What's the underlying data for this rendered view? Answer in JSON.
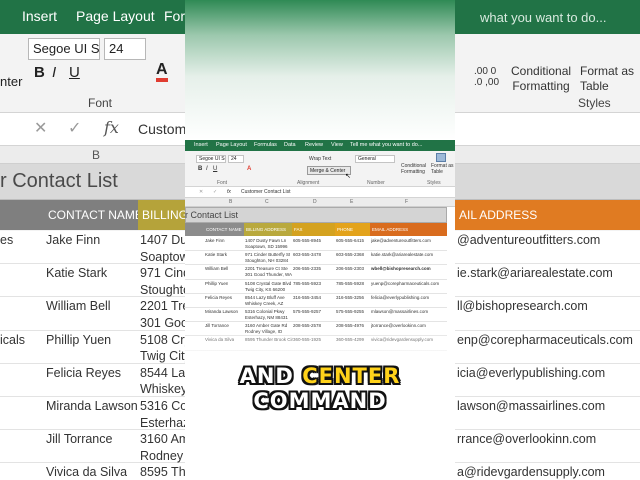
{
  "background": {
    "tabs": [
      "Insert",
      "Page Layout",
      "Form"
    ],
    "tell_me": "what you want to do...",
    "font_name": "Segoe UI Se",
    "font_size": "24",
    "bold": "B",
    "italic": "I",
    "underline": "U",
    "font_color_glyph": "A",
    "font_group_label": "Font",
    "enter_label": "nter",
    "number_small": ".00 0\n.0 ,00",
    "conditional_formatting": "Conditional\nFormatting",
    "format_as_table": "Format as\nTable",
    "styles_label": "Styles",
    "fx": "fx",
    "formula_value": "Custome",
    "column_b": "B",
    "title": "r Contact List",
    "headers": [
      "CONTACT NAME",
      "BILLING A",
      "AIL ADDRESS"
    ],
    "header_colors": [
      "#7f7f7f",
      "#b5a33a",
      "#e07b22"
    ],
    "rows": [
      {
        "a": "es",
        "name": "Jake Finn",
        "addr": "1407 Dus",
        "email": "@adventureoutfitters.com"
      },
      {
        "a": "",
        "name": "",
        "addr": "Soaptown",
        "email": ""
      },
      {
        "a": "",
        "name": "Katie Stark",
        "addr": "971 Cinde",
        "email": "ie.stark@ariarealestate.com"
      },
      {
        "a": "",
        "name": "",
        "addr": "Stoughton",
        "email": ""
      },
      {
        "a": "",
        "name": "William Bell",
        "addr": "2201 Trea",
        "email": "ll@bishopresearch.com"
      },
      {
        "a": "",
        "name": "",
        "addr": "301 Good",
        "email": ""
      },
      {
        "a": "icals",
        "name": "Phillip Yuen",
        "addr": "5108 Cry",
        "email": "enp@corepharmaceuticals.com"
      },
      {
        "a": "",
        "name": "",
        "addr": "Twig City,",
        "email": ""
      },
      {
        "a": "",
        "name": "Felicia Reyes",
        "addr": "8544 Laz",
        "email": "icia@everlypublishing.com"
      },
      {
        "a": "",
        "name": "",
        "addr": "Whiskey C",
        "email": ""
      },
      {
        "a": "",
        "name": "Miranda Lawson",
        "addr": "5316 Col",
        "email": "lawson@massairlines.com"
      },
      {
        "a": "",
        "name": "",
        "addr": "Esterhazy,",
        "email": ""
      },
      {
        "a": "",
        "name": "Jill Torrance",
        "addr": "3160 Amb",
        "email": "rrance@overlookinn.com"
      },
      {
        "a": "",
        "name": "",
        "addr": "Rodney V",
        "email": ""
      },
      {
        "a": "",
        "name": "Vivica da Silva",
        "addr": "8595 Thu",
        "email": "a@ridevgardensupply.com"
      }
    ]
  },
  "mini": {
    "tabs": [
      "Insert",
      "Page Layout",
      "Formulas",
      "Data",
      "Review",
      "View",
      "Tell me what you want to do..."
    ],
    "font_name": "Segoe UI Ser",
    "font_size": "24",
    "wrap_text": "Wrap Text",
    "merge_center": "Merge & Center",
    "number_format": "General",
    "conditional": "Conditional\nFormatting",
    "format_table": "Format as\nTable",
    "cell_styles": "Cell\nStyles",
    "font_label": "Font",
    "alignment_label": "Alignment",
    "number_label": "Number",
    "styles_label": "Styles",
    "formula_value": "Customer Contact List",
    "title": "r Contact List",
    "headers": [
      "CONTACT NAME",
      "BILLING ADDRESS",
      "FAX",
      "PHONE",
      "EMAIL ADDRESS"
    ],
    "header_colors": [
      "#8c8c8c",
      "#b9a93d",
      "#d4a21f",
      "#e3a31b",
      "#d96c1e"
    ],
    "rows": [
      {
        "name": "Jake Finn",
        "addr": "1407 Dusty Fawn Ln\nSoaptown, SD 15996",
        "fax": "605-555-8945",
        "phone": "605-555-6415",
        "email": "jake@adventureoutfitters.com"
      },
      {
        "name": "Katie Stark",
        "addr": "971 Cinder Butterfly St\nStoughton, NH 03284",
        "fax": "603-555-3478",
        "phone": "603-555-2368",
        "email": "katie.stark@ariarealestate.com"
      },
      {
        "name": "William Bell",
        "addr": "2201 Treasure Ct Ste\n301 Good Thunder, WA",
        "fax": "206-555-2335",
        "phone": "206-555-2303",
        "email": "wbell@bishopresearch.com"
      },
      {
        "name": "Phillip Yuen",
        "addr": "5108 Crystal Gate Blvd\nTwig City, KS 66200",
        "fax": "785-555-5923",
        "phone": "785-555-5928",
        "email": "yuenp@corepharmaceuticals.com"
      },
      {
        "name": "Felicia Reyes",
        "addr": "8544 Lazy Bluff Ave\nWhiskey Creek, AZ",
        "fax": "316-555-3454",
        "phone": "316-555-3256",
        "email": "felicia@everlypublishing.com"
      },
      {
        "name": "Miranda Lawson",
        "addr": "5316 Colonial Pkwy\nEsterhazy, NM 88431",
        "fax": "575-555-9257",
        "phone": "575-555-9255",
        "email": "mlawson@massairlines.com"
      },
      {
        "name": "Jill Torrance",
        "addr": "3160 Amber Gate Rd\nRodney Village, ID",
        "fax": "208-555-2578",
        "phone": "208-555-4976",
        "email": "jtorrance@overlookinn.com"
      },
      {
        "name": "Vivica da Silva",
        "addr": "8595 Thunder Brook Cir",
        "fax": "360-555-1925",
        "phone": "360-555-4299",
        "email": "vivica@ridevgardensupply.com"
      }
    ]
  },
  "caption": {
    "line1_white": "AND",
    "line1_yellow": "CENTER",
    "line2": "COMMAND"
  }
}
